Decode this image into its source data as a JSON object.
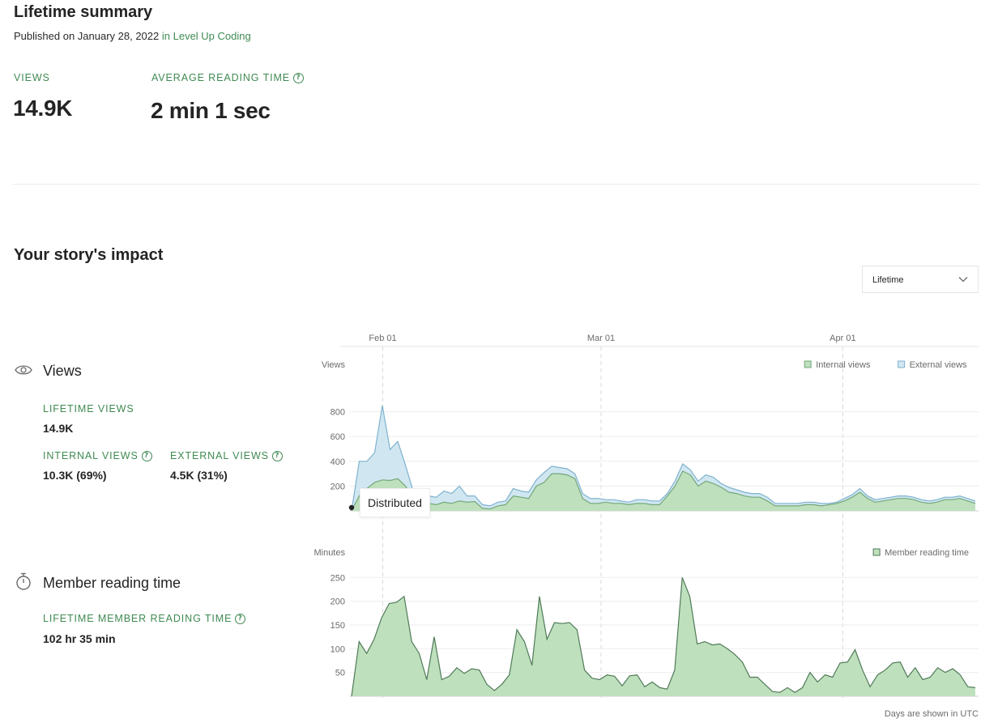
{
  "summary": {
    "title": "Lifetime summary",
    "published_prefix": "Published on January 28, 2022",
    "publication": "in Level Up Coding",
    "views_label": "VIEWS",
    "views_value": "14.9K",
    "avg_label": "AVERAGE READING TIME",
    "avg_value": "2 min 1 sec"
  },
  "impact": {
    "title": "Your story's impact",
    "range_selected": "Lifetime",
    "views": {
      "title": "Views",
      "lifetime_label": "LIFETIME VIEWS",
      "lifetime_value": "14.9K",
      "internal_label": "INTERNAL VIEWS",
      "internal_value": "10.3K (69%)",
      "external_label": "EXTERNAL VIEWS",
      "external_value": "4.5K (31%)"
    },
    "reading": {
      "title": "Member reading time",
      "lifetime_label": "LIFETIME MEMBER READING TIME",
      "lifetime_value": "102 hr 35 min"
    },
    "tooltip": "Distributed",
    "footnote": "Days are shown in UTC"
  },
  "colors": {
    "accent": "#3f8a52",
    "internal_fill": "#bfe0bd",
    "internal_line": "#74a77a",
    "external_fill": "#d0e7f2",
    "external_line": "#7fb2cd",
    "reading_fill": "#bfe0bd",
    "reading_line": "#4f7a58"
  },
  "chart_data": [
    {
      "type": "area",
      "x_tick_labels": [
        "Feb 01",
        "Mar 01",
        "Apr 01"
      ],
      "x_tick_dates": [
        "2022-02-01",
        "2022-03-01",
        "2022-04-01"
      ],
      "x_start": "2022-01-28",
      "x_end": "2022-04-18",
      "ylabel": "Views",
      "yticks": [
        200,
        400,
        600,
        800
      ],
      "ylim": [
        0,
        1000
      ],
      "stacked": true,
      "legend_position": "top-right",
      "series": [
        {
          "name": "Internal views",
          "values": [
            0,
            120,
            180,
            230,
            250,
            245,
            260,
            200,
            110,
            80,
            60,
            50,
            70,
            60,
            80,
            70,
            75,
            20,
            15,
            40,
            50,
            120,
            110,
            100,
            200,
            230,
            300,
            300,
            290,
            260,
            100,
            60,
            60,
            70,
            60,
            60,
            50,
            60,
            60,
            50,
            50,
            120,
            200,
            320,
            290,
            200,
            240,
            220,
            190,
            150,
            140,
            120,
            110,
            110,
            80,
            40,
            40,
            40,
            40,
            50,
            50,
            40,
            50,
            60,
            80,
            110,
            150,
            100,
            70,
            80,
            90,
            100,
            100,
            90,
            70,
            60,
            70,
            90,
            90,
            100,
            80,
            60
          ]
        },
        {
          "name": "External views",
          "values": [
            0,
            280,
            220,
            240,
            600,
            250,
            300,
            170,
            50,
            30,
            60,
            60,
            90,
            80,
            120,
            50,
            45,
            30,
            25,
            30,
            30,
            60,
            50,
            50,
            50,
            80,
            60,
            50,
            50,
            40,
            40,
            40,
            40,
            20,
            30,
            20,
            20,
            30,
            30,
            30,
            30,
            20,
            40,
            60,
            40,
            40,
            50,
            50,
            30,
            40,
            30,
            30,
            30,
            30,
            30,
            20,
            20,
            20,
            20,
            20,
            20,
            20,
            10,
            10,
            20,
            20,
            30,
            20,
            20,
            20,
            20,
            20,
            20,
            20,
            20,
            20,
            20,
            20,
            20,
            20,
            20,
            20
          ]
        }
      ],
      "annotations": [
        {
          "label": "Distributed",
          "date": "2022-01-28"
        }
      ]
    },
    {
      "type": "area",
      "x_tick_labels": [
        "Feb 01",
        "Mar 01",
        "Apr 01"
      ],
      "x_tick_dates": [
        "2022-02-01",
        "2022-03-01",
        "2022-04-01"
      ],
      "x_start": "2022-01-28",
      "x_end": "2022-04-18",
      "ylabel": "Minutes",
      "yticks": [
        50,
        100,
        150,
        200,
        250
      ],
      "ylim": [
        0,
        270
      ],
      "legend_position": "top-right",
      "series": [
        {
          "name": "Member reading time",
          "values": [
            0,
            115,
            90,
            120,
            165,
            195,
            198,
            210,
            115,
            90,
            35,
            125,
            35,
            42,
            60,
            48,
            58,
            55,
            25,
            12,
            25,
            45,
            140,
            115,
            65,
            210,
            120,
            155,
            153,
            155,
            140,
            55,
            38,
            35,
            45,
            42,
            22,
            43,
            45,
            20,
            30,
            18,
            15,
            55,
            250,
            210,
            110,
            115,
            108,
            110,
            100,
            88,
            72,
            40,
            40,
            25,
            10,
            8,
            18,
            8,
            18,
            50,
            30,
            45,
            40,
            70,
            72,
            98,
            55,
            20,
            45,
            55,
            70,
            72,
            40,
            60,
            35,
            40,
            60,
            50,
            58,
            45,
            20,
            18
          ]
        }
      ]
    }
  ]
}
